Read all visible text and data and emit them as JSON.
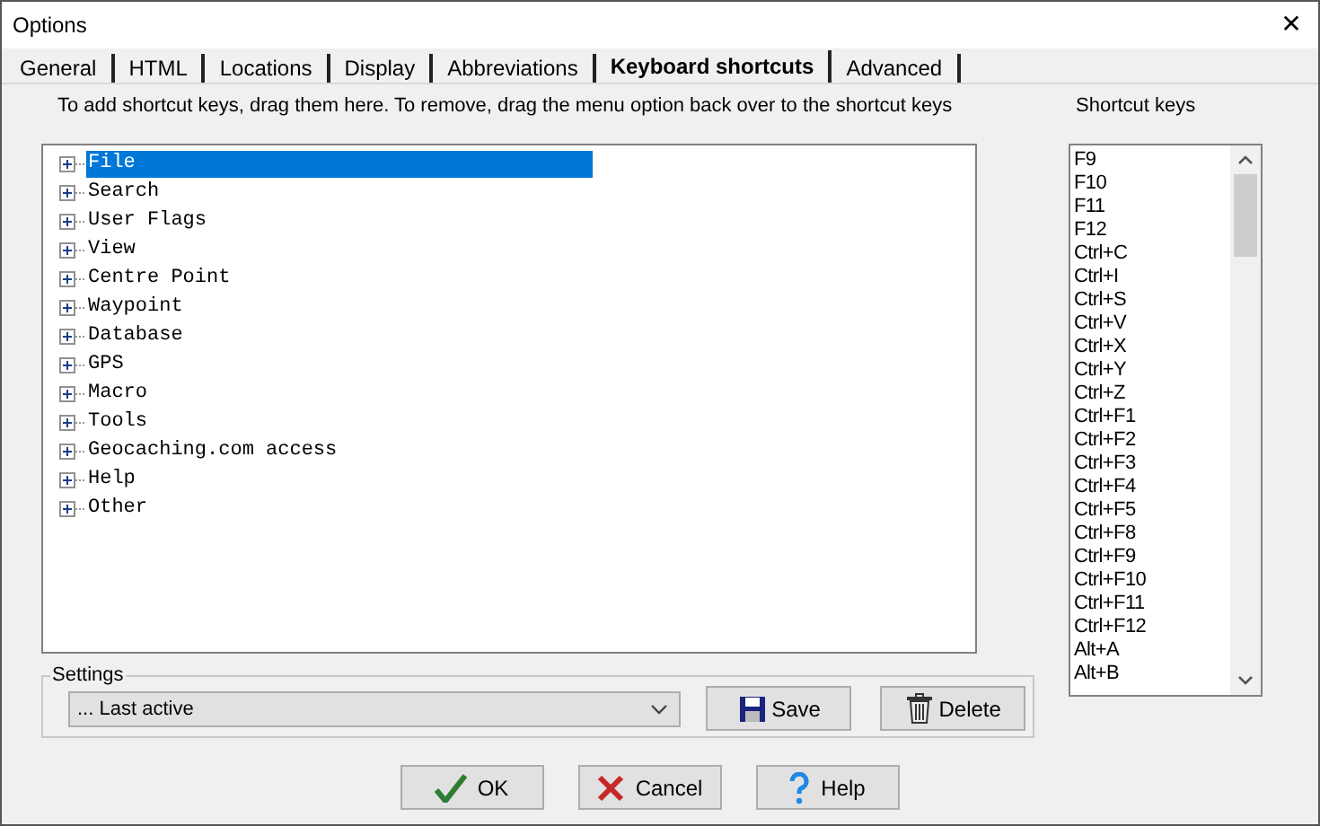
{
  "window": {
    "title": "Options",
    "close": "✕"
  },
  "tabs": [
    {
      "label": "General",
      "selected": false
    },
    {
      "label": "HTML",
      "selected": false
    },
    {
      "label": "Locations",
      "selected": false
    },
    {
      "label": "Display",
      "selected": false
    },
    {
      "label": "Abbreviations",
      "selected": false
    },
    {
      "label": "Keyboard shortcuts",
      "selected": true
    },
    {
      "label": "Advanced",
      "selected": false
    }
  ],
  "instructions": "To add shortcut keys, drag them here. To remove, drag the menu option back over to the shortcut keys",
  "tree": [
    {
      "label": "File",
      "selected": true,
      "expanded": false
    },
    {
      "label": "Search",
      "selected": false,
      "expanded": false
    },
    {
      "label": "User Flags",
      "selected": false,
      "expanded": false
    },
    {
      "label": "View",
      "selected": false,
      "expanded": false
    },
    {
      "label": "Centre Point",
      "selected": false,
      "expanded": false
    },
    {
      "label": "Waypoint",
      "selected": false,
      "expanded": false
    },
    {
      "label": "Database",
      "selected": false,
      "expanded": false
    },
    {
      "label": "GPS",
      "selected": false,
      "expanded": false
    },
    {
      "label": "Macro",
      "selected": false,
      "expanded": false
    },
    {
      "label": "Tools",
      "selected": false,
      "expanded": false
    },
    {
      "label": "Geocaching.com access",
      "selected": false,
      "expanded": false
    },
    {
      "label": "Help",
      "selected": false,
      "expanded": false
    },
    {
      "label": "Other",
      "selected": false,
      "expanded": false
    }
  ],
  "shortcut_keys": {
    "title": "Shortcut keys",
    "items": [
      "F9",
      "F10",
      "F11",
      "F12",
      "Ctrl+C",
      "Ctrl+I",
      "Ctrl+S",
      "Ctrl+V",
      "Ctrl+X",
      "Ctrl+Y",
      "Ctrl+Z",
      "Ctrl+F1",
      "Ctrl+F2",
      "Ctrl+F3",
      "Ctrl+F4",
      "Ctrl+F5",
      "Ctrl+F8",
      "Ctrl+F9",
      "Ctrl+F10",
      "Ctrl+F11",
      "Ctrl+F12",
      "Alt+A",
      "Alt+B"
    ]
  },
  "settings": {
    "title": "Settings",
    "value": "... Last active",
    "buttons": [
      {
        "label": "Save",
        "kind": "save"
      },
      {
        "label": "Delete",
        "kind": "delete"
      }
    ]
  },
  "buttons": [
    {
      "label": "OK",
      "kind": "ok"
    },
    {
      "label": "Cancel",
      "kind": "cancel"
    },
    {
      "label": "Help",
      "kind": "help"
    }
  ]
}
